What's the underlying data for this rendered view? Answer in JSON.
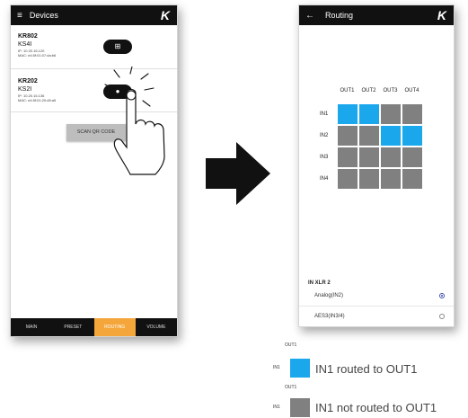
{
  "devices_screen": {
    "title": "Devices",
    "logo": "K",
    "menu_icon": "hamburger-icon",
    "devices": [
      {
        "name": "KR802",
        "model": "KS4I",
        "ip": "IP: 10.20.16.120",
        "mac": "MAC: e4:5f:01:07:da:b6",
        "button_icon": "grid-icon"
      },
      {
        "name": "KR202",
        "model": "KS2I",
        "ip": "IP: 10.20.16.136",
        "mac": "MAC: e4:5f:01:20:d5:a5",
        "button_icon": "identify-icon"
      }
    ],
    "scan_button": "SCAN QR CODE",
    "bottom_nav": [
      {
        "label": "MAIN",
        "active": false
      },
      {
        "label": "PRESET",
        "active": false
      },
      {
        "label": "ROUTING",
        "active": true
      },
      {
        "label": "VOLUME",
        "active": false
      }
    ],
    "accent_color": "#f4a63b"
  },
  "routing_screen": {
    "title": "Routing",
    "logo": "K",
    "back_icon": "arrow-left-icon",
    "outputs": [
      "OUT1",
      "OUT2",
      "OUT3",
      "OUT4"
    ],
    "inputs": [
      "IN1",
      "IN2",
      "IN3",
      "IN4"
    ],
    "matrix": [
      [
        true,
        true,
        false,
        false
      ],
      [
        false,
        false,
        true,
        true
      ],
      [
        false,
        false,
        false,
        false
      ],
      [
        false,
        false,
        false,
        false
      ]
    ],
    "routed_color": "#1aa7ec",
    "unrouted_color": "#808080",
    "section_title": "IN XLR 2",
    "options": [
      {
        "label": "Analog(IN2)",
        "selected": true
      },
      {
        "label": "AES3(IN3/4)",
        "selected": false
      }
    ]
  },
  "arrow_icon": "right-arrow-icon",
  "legend": [
    {
      "out": "OUT1",
      "in": "IN1",
      "text": "IN1 routed to OUT1",
      "color": "#1aa7ec"
    },
    {
      "out": "OUT1",
      "in": "IN1",
      "text": "IN1 not routed to OUT1",
      "color": "#808080"
    }
  ]
}
